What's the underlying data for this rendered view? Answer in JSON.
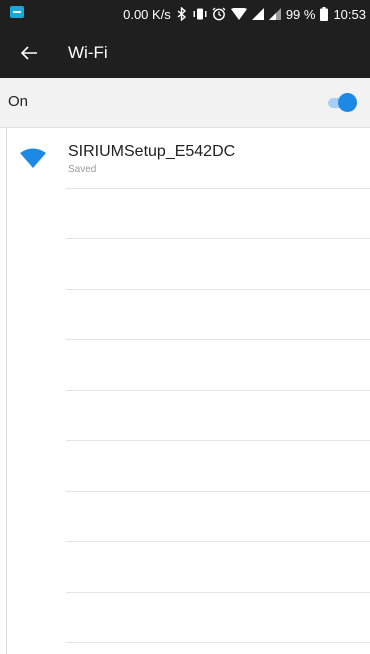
{
  "status_bar": {
    "speed": "0.00 K/s",
    "battery": "99 %",
    "time": "10:53",
    "icons": [
      "app-notification-icon",
      "bluetooth-icon",
      "vibrate-icon",
      "alarm-icon",
      "wifi-signal-icon",
      "cell-signal-icon",
      "cell-signal-icon",
      "battery-icon"
    ]
  },
  "app_bar": {
    "back_icon": "arrow-left-icon",
    "title": "Wi-Fi"
  },
  "wifi_toggle": {
    "label": "On",
    "state": "on",
    "accent_color": "#1e88e5"
  },
  "networks": [
    {
      "name": "SIRIUMSetup_E542DC",
      "status": "Saved",
      "icon": "wifi-icon",
      "icon_color": "#1e88e5"
    }
  ]
}
